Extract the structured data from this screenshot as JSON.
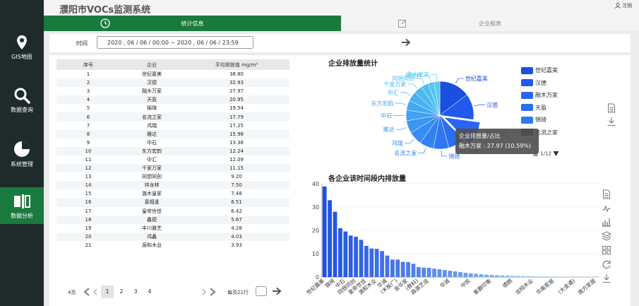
{
  "app": {
    "title": "濮阳市VOCs监测系统",
    "logout": "注销"
  },
  "nav": [
    {
      "label": "GIS地图",
      "icon": "map-pin-icon"
    },
    {
      "label": "数据查询",
      "icon": "search-icon"
    },
    {
      "label": "系统管理",
      "icon": "pie-icon"
    },
    {
      "label": "数据分析",
      "icon": "analysis-icon"
    }
  ],
  "tabs": {
    "stats": "统计信息",
    "report": "企业报表"
  },
  "filter": {
    "label": "时间",
    "value": "2020 , 06 / 06 / 00:00 ~ 2020 , 06 / 06 / 23:59"
  },
  "table": {
    "headers": [
      "序号",
      "企业",
      "平均排放值 mg/m³"
    ],
    "rows": [
      [
        "1",
        "世纪嘉美",
        "38.80"
      ],
      [
        "2",
        "汉德",
        "32.93"
      ],
      [
        "3",
        "融木万家",
        "27.97"
      ],
      [
        "4",
        "天盈",
        "20.95"
      ],
      [
        "5",
        "锦琦",
        "19.54"
      ],
      [
        "6",
        "名流之家",
        "17.79"
      ],
      [
        "7",
        "鸿瑞",
        "17.25"
      ],
      [
        "8",
        "雅达",
        "15.96"
      ],
      [
        "9",
        "中石",
        "13.38"
      ],
      [
        "10",
        "东方宏韵",
        "12.24"
      ],
      [
        "11",
        "中汇",
        "12.09"
      ],
      [
        "12",
        "千家万家",
        "11.15"
      ],
      [
        "13",
        "同想同创",
        "9.20"
      ],
      [
        "14",
        "祥龙林",
        "7.50"
      ],
      [
        "15",
        "潞木皇家",
        "7.48"
      ],
      [
        "16",
        "喜相逢",
        "6.51"
      ],
      [
        "17",
        "皇帝世佳",
        "6.42"
      ],
      [
        "18",
        "鑫德",
        "5.67"
      ],
      [
        "19",
        "丰川雅艺",
        "4.28"
      ],
      [
        "20",
        "鸿鑫",
        "4.03"
      ],
      [
        "21",
        "源和木业",
        "3.93"
      ]
    ]
  },
  "pager": {
    "total": "4页",
    "pages": [
      "1",
      "2",
      "3",
      "4"
    ],
    "per_page": "每页21行"
  },
  "pie": {
    "title": "企业排放量统计",
    "legend": [
      "世纪嘉美",
      "汉德",
      "融木万家",
      "天盈",
      "锦琦",
      "名流之家"
    ],
    "legend_page": "1/12",
    "tooltip_title": "企业排放量/占比",
    "tooltip_value": "融木万家 : 27.97 (10.59%)"
  },
  "bar": {
    "title": "各企业该时间段内排放量"
  },
  "chart_data": [
    {
      "type": "pie",
      "title": "企业排放量统计",
      "labels": [
        "世纪嘉美",
        "汉德",
        "融木万家",
        "天盈",
        "锦琦",
        "名流之家",
        "鸿瑞",
        "雅达",
        "中石",
        "东方宏韵",
        "中汇",
        "千家万家",
        "同想同创",
        "祥龙林",
        "潞木皇家"
      ],
      "values": [
        38.8,
        32.93,
        27.97,
        20.95,
        19.54,
        17.79,
        17.25,
        15.96,
        13.38,
        12.24,
        12.09,
        11.15,
        9.2,
        7.5,
        7.48
      ],
      "colors": [
        "#1a4fe0",
        "#1f5aec",
        "#2a64f2",
        "#2b6ef0",
        "#3078f2",
        "#3482f2",
        "#388cf2",
        "#3c96f2",
        "#40a0f2",
        "#44a8f2",
        "#48b0f2",
        "#4cb8f0",
        "#50bff0",
        "#54c6ef",
        "#58ccef"
      ]
    },
    {
      "type": "bar",
      "title": "各企业该时间段内排放量",
      "categories": [
        "世纪嘉美",
        "",
        "锦琦",
        "",
        "中石",
        "",
        "同想同创",
        "",
        "皇帝世佳",
        "",
        "源和木业",
        "",
        "华诚",
        "",
        "(木板厂)",
        "",
        "金华家",
        "",
        "(骨科)",
        "",
        "森源艺佳",
        "",
        "",
        "",
        "华诚",
        "",
        "",
        "",
        "中凯",
        "",
        "",
        "",
        "紫爵印象",
        "",
        "",
        "",
        "德朗",
        "",
        "",
        "",
        "龙翔木业",
        "",
        "",
        "",
        "华南家居",
        "",
        "",
        "",
        "(大金通)",
        "",
        "",
        "",
        "南方家居"
      ],
      "values": [
        38.8,
        32.93,
        27.97,
        20.95,
        19.54,
        17.79,
        17.25,
        15.96,
        13.38,
        12.24,
        12.09,
        11.15,
        9.2,
        7.5,
        7.48,
        6.51,
        6.42,
        5.67,
        4.28,
        4.03,
        3.93,
        3.6,
        3.3,
        3.0,
        2.7,
        2.4,
        2.1,
        1.8,
        1.6,
        1.4,
        1.2,
        1.0,
        0.9,
        0.8,
        0.7,
        0.6,
        0.5,
        0.45,
        0.4,
        0.35,
        0.3,
        0.28,
        0.25,
        0.22,
        0.2,
        0.18,
        0.15,
        0.12,
        0.1,
        0.08,
        0.06,
        0.05,
        0.03
      ],
      "ylim": [
        0,
        40
      ],
      "yticks": [
        0,
        10,
        20,
        30,
        40
      ]
    }
  ]
}
